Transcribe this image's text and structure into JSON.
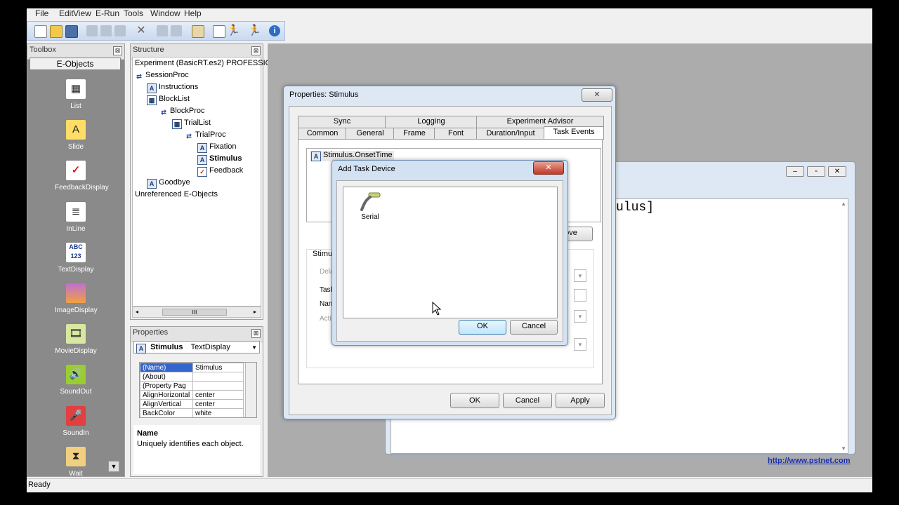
{
  "menu": [
    "File",
    "Edit",
    "View",
    "E-Run",
    "Tools",
    "Window",
    "Help"
  ],
  "toolbox": {
    "title": "Toolbox",
    "tab": "E-Objects",
    "items": [
      "List",
      "Slide",
      "FeedbackDisplay",
      "InLine",
      "TextDisplay",
      "ImageDisplay",
      "MovieDisplay",
      "SoundOut",
      "SoundIn",
      "Wait"
    ]
  },
  "structure": {
    "title": "Structure",
    "root": "Experiment (BasicRT.es2) PROFESSIC",
    "nodes": [
      "SessionProc",
      "Instructions",
      "BlockList",
      "BlockProc",
      "TrialList",
      "TrialProc",
      "Fixation",
      "Stimulus",
      "Feedback",
      "Goodbye",
      "Unreferenced E-Objects"
    ],
    "scroll_mark": "III"
  },
  "properties": {
    "title": "Properties",
    "object_name": "Stimulus",
    "object_type": "TextDisplay",
    "rows": [
      {
        "name": "(Name)",
        "value": "Stimulus"
      },
      {
        "name": "(About)",
        "value": ""
      },
      {
        "name": "(Property Pag",
        "value": ""
      },
      {
        "name": "AlignHorizontal",
        "value": "center"
      },
      {
        "name": "AlignVertical",
        "value": "center"
      },
      {
        "name": "BackColor",
        "value": "white"
      }
    ],
    "desc_title": "Name",
    "desc_text": "Uniquely identifies each object."
  },
  "stim_dialog": {
    "title": "Properties: Stimulus",
    "tabs_row1": [
      "Sync",
      "Logging",
      "Experiment Advisor"
    ],
    "tabs_row2": [
      "Common",
      "General",
      "Frame",
      "Font",
      "Duration/Input",
      "Task Events"
    ],
    "list_item": "Stimulus.OnsetTime",
    "remove_label": "ove",
    "section_label": "Stimul",
    "field_labels": [
      "Dela",
      "Task",
      "Nam",
      "Actio"
    ],
    "ok": "OK",
    "cancel": "Cancel",
    "apply": "Apply"
  },
  "editor": {
    "text": "ulus]"
  },
  "add_device": {
    "title": "Add Task Device",
    "device": "Serial",
    "ok": "OK",
    "cancel": "Cancel"
  },
  "link": "http://www.pstnet.com",
  "status": "Ready"
}
